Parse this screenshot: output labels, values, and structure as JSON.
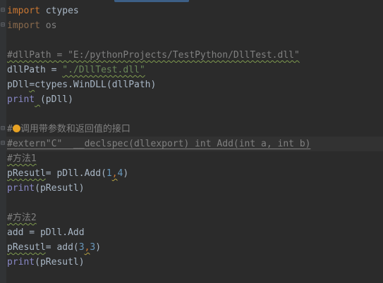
{
  "code": {
    "l1_kw": "import",
    "l1_rest": " ctypes",
    "l2_kw": "import",
    "l2_rest": " os",
    "l4_comment": "#dllPath = \"E:/pythonProjects/TestPython/DllTest.dll\"",
    "l5_var": "dllPath = ",
    "l5_str": "\"./DllTest.dll\"",
    "l6_a": "pDll",
    "l6_b": "=",
    "l6_c": "ctypes.WinDLL(dllPath)",
    "l7_a": "print",
    "l7_b": " ",
    "l7_c": "(pDll)",
    "l9_hash": "#",
    "l9_text": "调用带参数和返回值的接口",
    "l10_comment": "#extern\"C\"  __declspec(dllexport) int Add(int a, int b)",
    "l11_comment": "#方法1",
    "l12_a": "pResutl",
    "l12_b": "= pDll.Add(",
    "l12_n1": "1",
    "l12_sep": ",",
    "l12_n2": "4",
    "l12_end": ")",
    "l13_a": "print",
    "l13_b": "(pResutl)",
    "l15_comment": "#方法2",
    "l16": "add = pDll.Add",
    "l17_a": "pResutl",
    "l17_b": "= add(",
    "l17_n1": "3",
    "l17_sep": ",",
    "l17_n2": "3",
    "l17_end": ")",
    "l18_a": "print",
    "l18_b": "(pResutl)"
  },
  "colors": {
    "background": "#2b2b2b",
    "keyword": "#cc7832",
    "comment": "#808080",
    "string": "#6a8759",
    "number": "#6897bb",
    "builtin": "#8888c6",
    "text": "#a9b7c6"
  },
  "icons": {
    "fold_marker": "fold-icon",
    "intention_bulb": "lightbulb-icon"
  }
}
